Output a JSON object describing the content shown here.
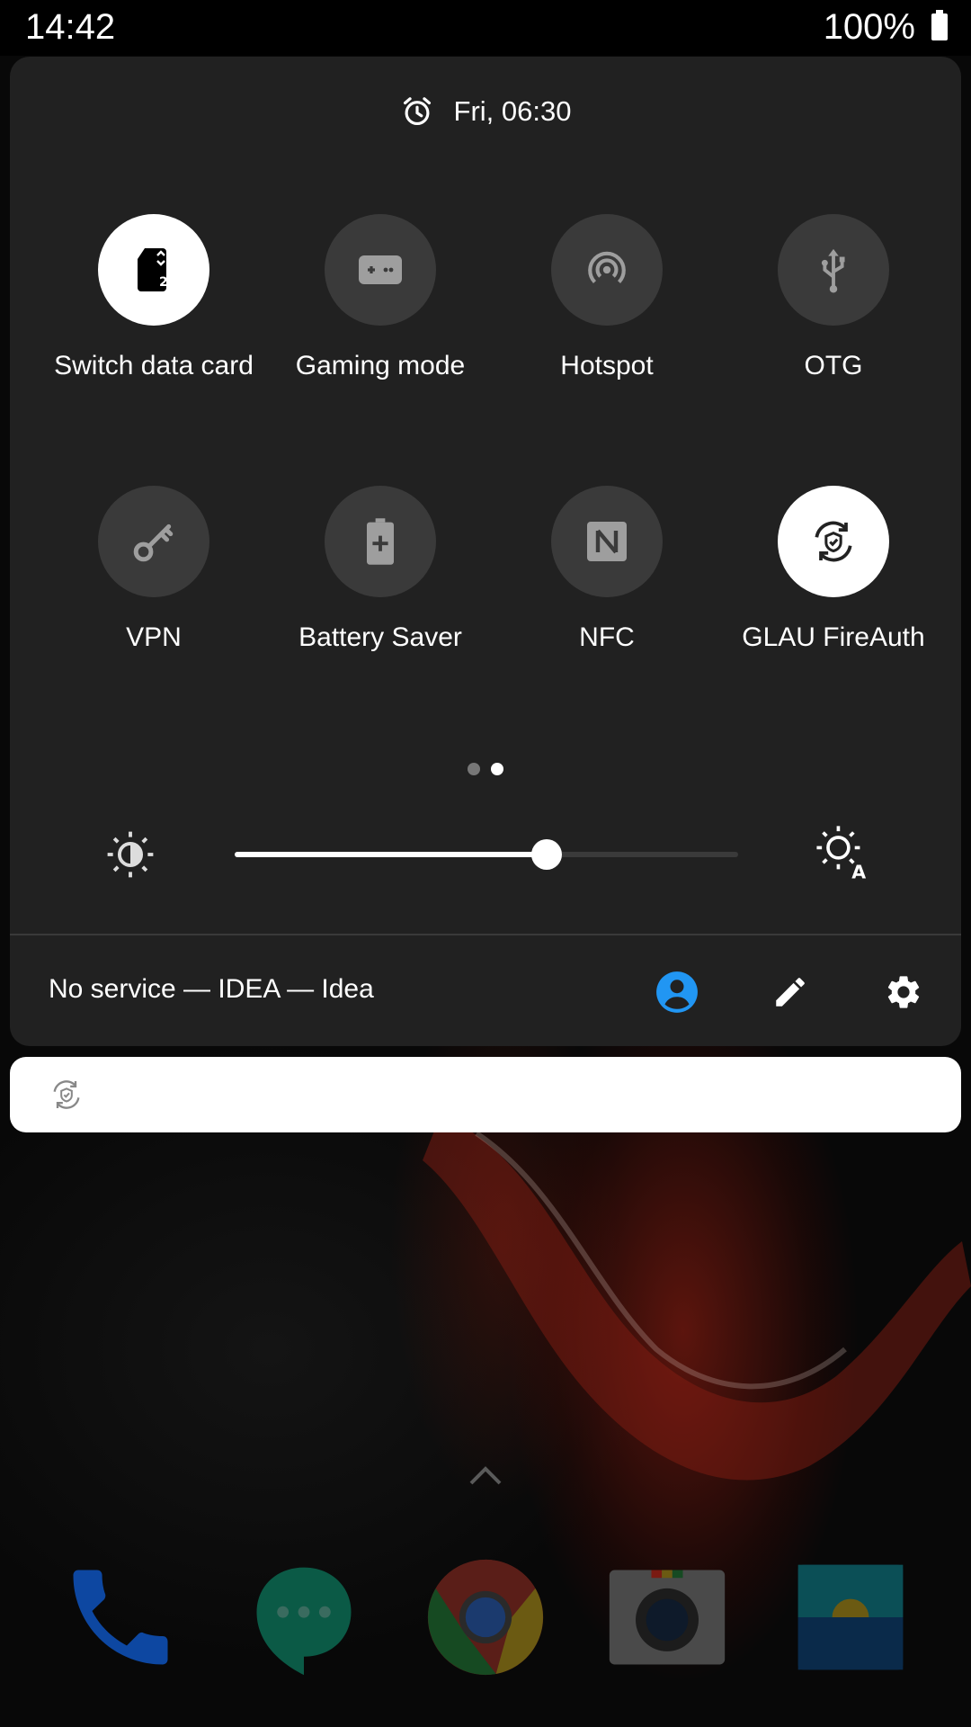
{
  "status_bar": {
    "time": "14:42",
    "battery": "100%"
  },
  "quick_settings": {
    "alarm": "Fri, 06:30",
    "tiles": [
      {
        "label": "Switch data card",
        "icon": "sim-card-2-icon",
        "active": true
      },
      {
        "label": "Gaming mode",
        "icon": "gamepad-icon",
        "active": false
      },
      {
        "label": "Hotspot",
        "icon": "hotspot-icon",
        "active": false
      },
      {
        "label": "OTG",
        "icon": "usb-icon",
        "active": false
      },
      {
        "label": "VPN",
        "icon": "key-icon",
        "active": false
      },
      {
        "label": "Battery Saver",
        "icon": "battery-plus-icon",
        "active": false
      },
      {
        "label": "NFC",
        "icon": "nfc-icon",
        "active": false
      },
      {
        "label": "GLAU FireAuth",
        "icon": "fireauth-sync-icon",
        "active": true
      }
    ],
    "page_indicator": {
      "pages": 2,
      "current": 2
    },
    "brightness": {
      "level_fraction": 0.62,
      "auto_label": "A"
    },
    "carrier_text": "No service — IDEA — Idea",
    "accent": "#2196F3"
  },
  "notification": {
    "icon": "fireauth-sync-icon"
  },
  "home": {
    "dock": [
      "phone-app-icon",
      "messages-app-icon",
      "chrome-app-icon",
      "camera-app-icon",
      "gallery-app-icon"
    ]
  }
}
